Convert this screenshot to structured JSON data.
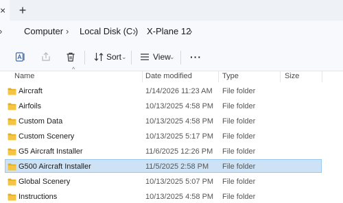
{
  "tabs": {
    "close_glyph": "×",
    "new_tab_glyph": "+"
  },
  "breadcrumb": {
    "lead_sep": "›",
    "items": [
      "Computer",
      "Local Disk (C:)",
      "X-Plane 12"
    ],
    "trailing_sep": "›"
  },
  "toolbar": {
    "sort_label": "Sort",
    "view_label": "View",
    "more_label": "···",
    "chevron": "⌄"
  },
  "columns": {
    "name": "Name",
    "date": "Date modified",
    "type": "Type",
    "size": "Size"
  },
  "colors": {
    "folder": "#f4c542",
    "folder_tab": "#e2ad22",
    "selection_bg": "#cde3f5",
    "selection_border": "#99c8ef"
  },
  "files": [
    {
      "name": "Aircraft",
      "date": "1/14/2026 11:23 AM",
      "type": "File folder",
      "selected": false
    },
    {
      "name": "Airfoils",
      "date": "10/13/2025 4:58 PM",
      "type": "File folder",
      "selected": false
    },
    {
      "name": "Custom Data",
      "date": "10/13/2025 4:58 PM",
      "type": "File folder",
      "selected": false
    },
    {
      "name": "Custom Scenery",
      "date": "10/13/2025 5:17 PM",
      "type": "File folder",
      "selected": false
    },
    {
      "name": "G5 Aircraft Installer",
      "date": "11/6/2025 12:26 PM",
      "type": "File folder",
      "selected": false
    },
    {
      "name": "G500 Aircraft Installer",
      "date": "11/5/2025 2:58 PM",
      "type": "File folder",
      "selected": true
    },
    {
      "name": "Global Scenery",
      "date": "10/13/2025 5:07 PM",
      "type": "File folder",
      "selected": false
    },
    {
      "name": "Instructions",
      "date": "10/13/2025 4:58 PM",
      "type": "File folder",
      "selected": false
    }
  ]
}
